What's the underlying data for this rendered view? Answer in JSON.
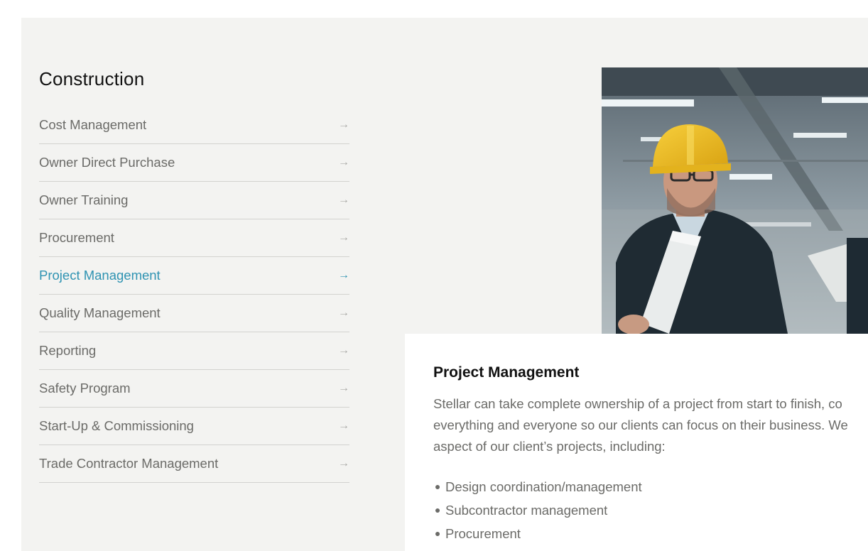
{
  "section": {
    "title": "Construction"
  },
  "nav": {
    "items": [
      {
        "label": "Cost Management",
        "active": false
      },
      {
        "label": "Owner Direct Purchase",
        "active": false
      },
      {
        "label": "Owner Training",
        "active": false
      },
      {
        "label": "Procurement",
        "active": false
      },
      {
        "label": "Project Management",
        "active": true
      },
      {
        "label": "Quality Management",
        "active": false
      },
      {
        "label": "Reporting",
        "active": false
      },
      {
        "label": "Safety Program",
        "active": false
      },
      {
        "label": "Start-Up & Commissioning",
        "active": false
      },
      {
        "label": "Trade Contractor Management",
        "active": false
      }
    ],
    "arrow_icon": "arrow-right-icon",
    "arrow_glyph": "→"
  },
  "content": {
    "title": "Project Management",
    "body_lines": [
      "Stellar can take complete ownership of a project from start to finish, co",
      "everything and everyone so our clients can focus on their business. We",
      "aspect of our client’s projects, including:"
    ],
    "bullets": [
      "Design coordination/management",
      "Subcontractor management",
      "Procurement"
    ]
  },
  "colors": {
    "accent": "#2f93b2",
    "panel_bg": "#f3f3f1",
    "text_muted": "#6b6b68"
  }
}
